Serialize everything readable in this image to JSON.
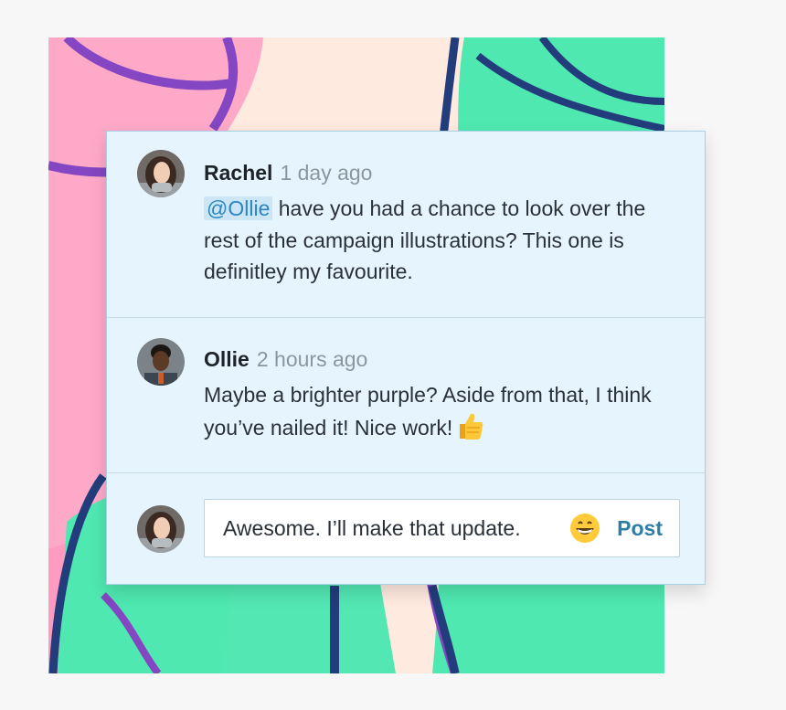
{
  "comments": [
    {
      "author": "Rachel",
      "time": "1 day ago",
      "mention": "@Ollie",
      "text": " have you had a chance to look over the rest of the campaign illustrations? This one is definitley my favourite."
    },
    {
      "author": "Ollie",
      "time": "2 hours ago",
      "text": "Maybe a brighter purple? Aside from that, I think you’ve nailed it! Nice work!",
      "emoji": "thumbs-up-emoji"
    }
  ],
  "reply": {
    "value": "Awesome. I’ll make that update.",
    "emoji": "grinning-emoji",
    "post_label": "Post"
  },
  "colors": {
    "panel_background": "#e6f5fd",
    "mention": "#2a86c1",
    "post": "#2f7fa5",
    "art_pink": "#ffa9c9",
    "art_green": "#4fe8b1",
    "art_purple": "#8446c2",
    "art_navy": "#233d7c"
  }
}
